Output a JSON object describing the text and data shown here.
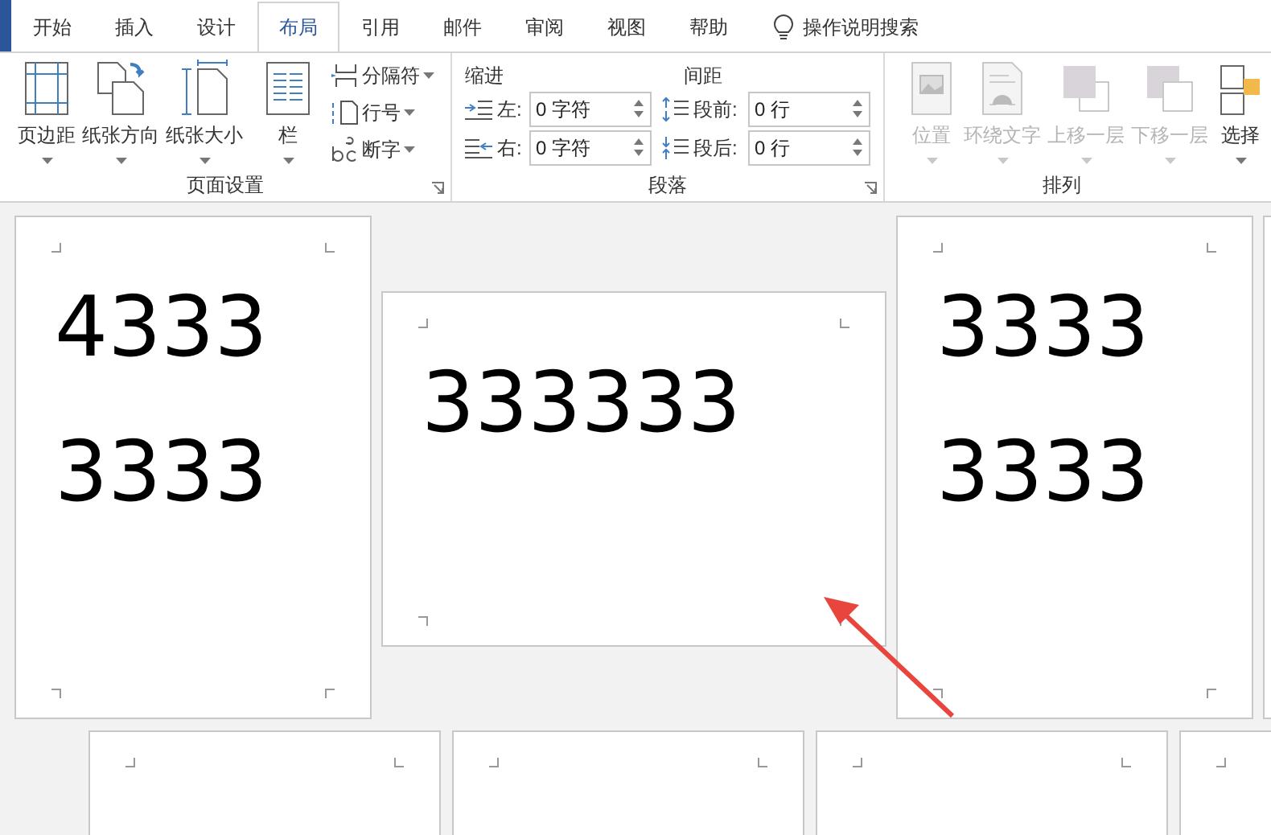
{
  "tabs": [
    {
      "label": "开始",
      "selected": false
    },
    {
      "label": "插入",
      "selected": false
    },
    {
      "label": "设计",
      "selected": false
    },
    {
      "label": "布局",
      "selected": true
    },
    {
      "label": "引用",
      "selected": false
    },
    {
      "label": "邮件",
      "selected": false
    },
    {
      "label": "审阅",
      "selected": false
    },
    {
      "label": "视图",
      "selected": false
    },
    {
      "label": "帮助",
      "selected": false
    }
  ],
  "tell_me": {
    "label": "操作说明搜索"
  },
  "page_setup": {
    "label": "页面设置",
    "large_buttons": [
      {
        "kind": "margins",
        "label": "页边距"
      },
      {
        "kind": "orientation",
        "label": "纸张方向"
      },
      {
        "kind": "size",
        "label": "纸张大小"
      },
      {
        "kind": "columns",
        "label": "栏"
      }
    ],
    "small_buttons": [
      {
        "kind": "breaks",
        "label": "分隔符"
      },
      {
        "kind": "line_numbers",
        "label": "行号"
      },
      {
        "kind": "hyphenation",
        "label": "断字"
      }
    ]
  },
  "paragraph": {
    "label": "段落",
    "indent": {
      "title": "缩进",
      "fields": [
        {
          "kind": "left",
          "label": "左:",
          "value": "0 字符"
        },
        {
          "kind": "right",
          "label": "右:",
          "value": "0 字符"
        }
      ]
    },
    "spacing": {
      "title": "间距",
      "fields": [
        {
          "kind": "before",
          "label": "段前:",
          "value": "0 行"
        },
        {
          "kind": "after",
          "label": "段后:",
          "value": "0 行"
        }
      ]
    }
  },
  "arrange": {
    "label": "排列",
    "buttons": [
      {
        "kind": "position",
        "label": "位置",
        "disabled": true
      },
      {
        "kind": "wrap",
        "label": "环绕文字",
        "disabled": true
      },
      {
        "kind": "forward",
        "label": "上移一层",
        "disabled": true
      },
      {
        "kind": "backward",
        "label": "下移一层",
        "disabled": true
      },
      {
        "kind": "selection",
        "label": "选择",
        "disabled": false
      }
    ]
  },
  "pages": [
    {
      "lines": [
        "4333",
        "3333"
      ]
    },
    {
      "lines": [
        "333333"
      ]
    },
    {
      "lines": [
        "3333",
        "3333"
      ]
    }
  ]
}
